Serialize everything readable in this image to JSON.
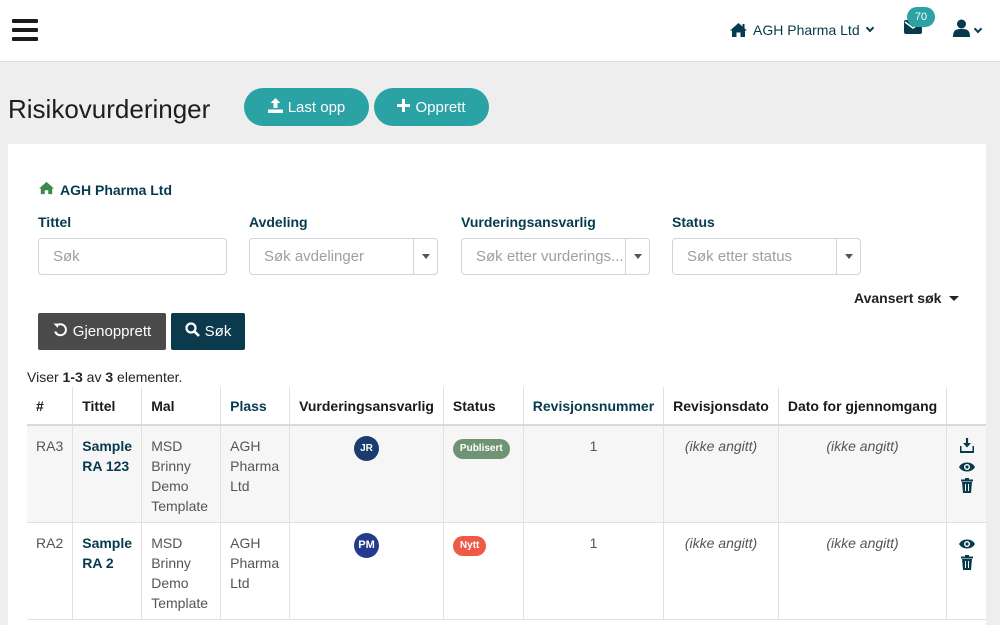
{
  "header": {
    "org_name": "AGH Pharma Ltd",
    "mail_count": "70"
  },
  "page": {
    "title": "Risikovurderinger",
    "upload_label": "Last opp",
    "create_label": "Opprett"
  },
  "filters": {
    "org_label": "AGH Pharma Ltd",
    "title_label": "Tittel",
    "title_placeholder": "Søk",
    "department_label": "Avdeling",
    "department_placeholder": "Søk avdelinger",
    "assessor_label": "Vurderingsansvarlig",
    "assessor_placeholder": "Søk etter vurderings...",
    "status_label": "Status",
    "status_placeholder": "Søk etter status",
    "advanced_label": "Avansert søk",
    "reset_label": "Gjenopprett",
    "search_label": "Søk"
  },
  "summary": {
    "prefix": "Viser ",
    "range": "1-3",
    "middle": " av ",
    "total": "3",
    "suffix": " elementer."
  },
  "table": {
    "columns": [
      "#",
      "Tittel",
      "Mal",
      "Plass",
      "Vurderingsansvarlig",
      "Status",
      "Revisjonsnummer",
      "Revisjonsdato",
      "Dato for gjennomgang"
    ],
    "rows": [
      {
        "id": "RA3",
        "title": "Sample RA 123",
        "template": "MSD Brinny Demo Template",
        "location": "AGH Pharma Ltd",
        "assessor_initials": "JR",
        "status": "Publisert",
        "revision": "1",
        "revision_date": "(ikke angitt)",
        "review_date": "(ikke angitt)"
      },
      {
        "id": "RA2",
        "title": "Sample RA 2",
        "template": "MSD Brinny Demo Template",
        "location": "AGH Pharma Ltd",
        "assessor_initials": "PM",
        "status": "Nytt",
        "revision": "1",
        "revision_date": "(ikke angitt)",
        "review_date": "(ikke angitt)"
      }
    ]
  },
  "colors": {
    "accent": "#2ba2a4",
    "navy": "#063b4e",
    "status_published": "#6f9474",
    "status_new": "#ef5a47",
    "not_set": "#b0464b"
  },
  "icons": [
    "menu-icon",
    "home-icon",
    "envelope-icon",
    "user-icon",
    "upload-icon",
    "plus-icon",
    "undo-icon",
    "search-icon",
    "download-icon",
    "eye-icon",
    "trash-icon"
  ]
}
